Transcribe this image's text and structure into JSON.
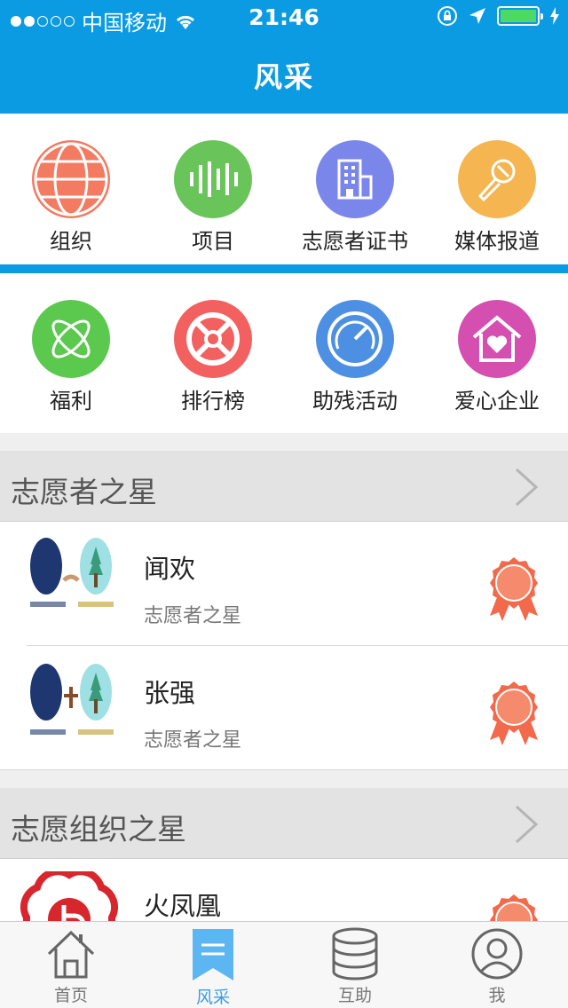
{
  "status_bar": {
    "carrier": "中国移动",
    "time": "21:46"
  },
  "nav": {
    "title": "风采"
  },
  "grid_top": [
    {
      "label": "组织",
      "icon": "globe-icon",
      "color": "#f27b62"
    },
    {
      "label": "项目",
      "icon": "bars-icon",
      "color": "#69c45a"
    },
    {
      "label": "志愿者证书",
      "icon": "building-icon",
      "color": "#7a86ea"
    },
    {
      "label": "媒体报道",
      "icon": "microphone-icon",
      "color": "#f5b551"
    }
  ],
  "grid_bottom": [
    {
      "label": "福利",
      "icon": "atom-icon",
      "color": "#5bc84e"
    },
    {
      "label": "排行榜",
      "icon": "wheel-icon",
      "color": "#f2605f"
    },
    {
      "label": "助残活动",
      "icon": "gauge-icon",
      "color": "#4d90e3"
    },
    {
      "label": "爱心企业",
      "icon": "heart-house-icon",
      "color": "#d54fb0"
    }
  ],
  "sections": [
    {
      "title": "志愿者之星",
      "items": [
        {
          "name": "闻欢",
          "subtitle": "志愿者之星"
        },
        {
          "name": "张强",
          "subtitle": "志愿者之星"
        }
      ]
    },
    {
      "title": "志愿组织之星",
      "items": [
        {
          "name": "火凤凰",
          "subtitle": ""
        }
      ]
    }
  ],
  "tabs": [
    {
      "label": "首页",
      "icon": "home-icon"
    },
    {
      "label": "风采",
      "icon": "bookmark-icon",
      "active": true
    },
    {
      "label": "互助",
      "icon": "database-icon"
    },
    {
      "label": "我",
      "icon": "user-icon"
    }
  ],
  "colors": {
    "primary": "#0a9be3",
    "medal": "#f26a4b",
    "tab_active": "#3b9be3"
  }
}
